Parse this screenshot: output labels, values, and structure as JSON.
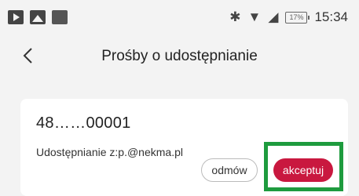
{
  "status_bar": {
    "time": "15:34",
    "battery": "17%",
    "icons": [
      "video-icon",
      "image-icon",
      "notification-icon",
      "bluetooth-icon",
      "wifi-icon",
      "signal-icon",
      "battery-icon"
    ]
  },
  "header": {
    "title": "Prośby o udostępnianie",
    "back_icon": "chevron-left-icon"
  },
  "request": {
    "device_id": "48……00001",
    "share_prefix": "Udostępnianie z:p.",
    "share_email_suffix": "@nekma.pl",
    "decline_label": "odmów",
    "accept_label": "akceptuj"
  },
  "colors": {
    "accent": "#c9183f",
    "highlight": "#1e9b3e",
    "background": "#f3f3f3"
  }
}
